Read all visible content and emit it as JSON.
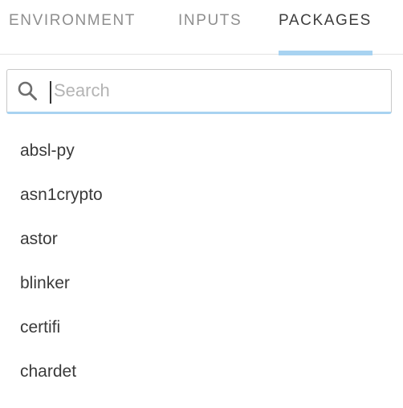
{
  "tabs": [
    {
      "label": "ENVIRONMENT",
      "active": false
    },
    {
      "label": "INPUTS",
      "active": false
    },
    {
      "label": "PACKAGES",
      "active": true
    }
  ],
  "search": {
    "placeholder": "Search",
    "value": "",
    "icon": "search-icon"
  },
  "packages": [
    "absl-py",
    "asn1crypto",
    "astor",
    "blinker",
    "certifi",
    "chardet"
  ],
  "colors": {
    "accent": "#a8d3f1",
    "active_tab_text": "#3d3d3d",
    "inactive_tab_text": "#8e8e8e",
    "list_text": "#3a3a3a"
  }
}
